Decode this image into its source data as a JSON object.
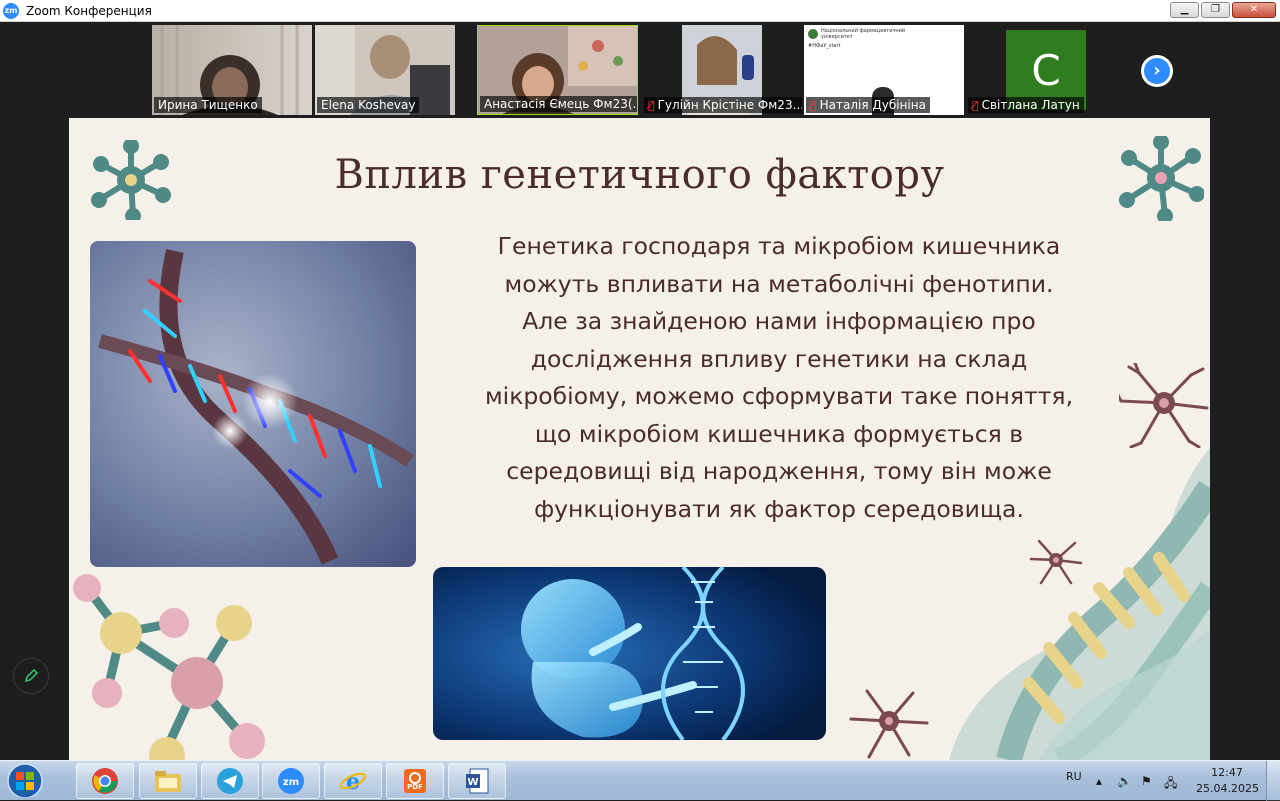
{
  "window": {
    "title": "Zoom Конференция",
    "app_icon": "zm",
    "buttons": [
      "minimize",
      "restore",
      "close"
    ]
  },
  "participants": [
    {
      "name": "Ирина Тищенко",
      "muted": false
    },
    {
      "name": "Elena Koshevay",
      "muted": false
    },
    {
      "name": "Анастасія Ємець Фм23(...",
      "muted": false,
      "active_speaker": true
    },
    {
      "name": "Гулійн Крістіне Фм23...",
      "muted": true
    },
    {
      "name": "Наталія Дубініна",
      "muted": true
    },
    {
      "name": "Світлана Латун",
      "muted": true,
      "avatar_letter": "С"
    }
  ],
  "shared_screen_thumb": {
    "line1": "Національний фармацевтичний",
    "line2": "університет",
    "line3": "#НФаУ_start"
  },
  "slide": {
    "title": "Вплив генетичного фактору",
    "body_lines": [
      "Генетика господаря та мікробіом кишечника",
      "можуть впливати на метаболічні фенотипи.",
      "Але за знайденою нами інформацією про",
      "дослідження впливу генетики на склад",
      "мікробіому, можемо сформувати таке поняття,",
      "що мікробіом кишечника формується в",
      "середовищі від народження, тому він може",
      "функціонувати як фактор середовища."
    ],
    "colors": {
      "background": "#f5f1ea",
      "text": "#4a2b2e",
      "teal": "#4f8a86",
      "pink": "#d9a0ab",
      "yellow": "#e8d38a"
    }
  },
  "taskbar": {
    "apps": [
      "chrome-icon",
      "explorer-icon",
      "telegram-icon",
      "zoom-icon",
      "ie-icon",
      "pdf-icon",
      "word-icon"
    ],
    "lang": "RU",
    "time": "12:47",
    "date": "25.04.2025"
  }
}
